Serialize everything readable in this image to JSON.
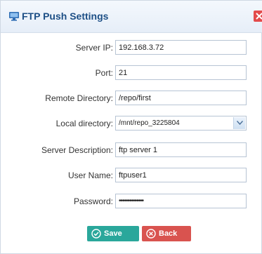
{
  "dialog": {
    "title": "FTP Push Settings",
    "title_icon": "monitor-icon",
    "close_icon": "close-icon"
  },
  "form": {
    "server_ip": {
      "label": "Server IP:",
      "value": "192.168.3.72"
    },
    "port": {
      "label": "Port:",
      "value": "21"
    },
    "remote_directory": {
      "label": "Remote Directory:",
      "value": "/repo/first"
    },
    "local_directory": {
      "label": "Local directory:",
      "value": "/mnt/repo_3225804"
    },
    "server_description": {
      "label": "Server Description:",
      "value": "ftp server 1"
    },
    "user_name": {
      "label": "User Name:",
      "value": "ftpuser1"
    },
    "password": {
      "label": "Password:",
      "value": "••••••••••••••"
    }
  },
  "buttons": {
    "save": {
      "label": "Save",
      "icon": "check-circle-icon",
      "color": "#2aa79b"
    },
    "back": {
      "label": "Back",
      "icon": "x-circle-icon",
      "color": "#d9534f"
    }
  },
  "colors": {
    "title": "#1d4f86",
    "close": "#e34b4b"
  }
}
